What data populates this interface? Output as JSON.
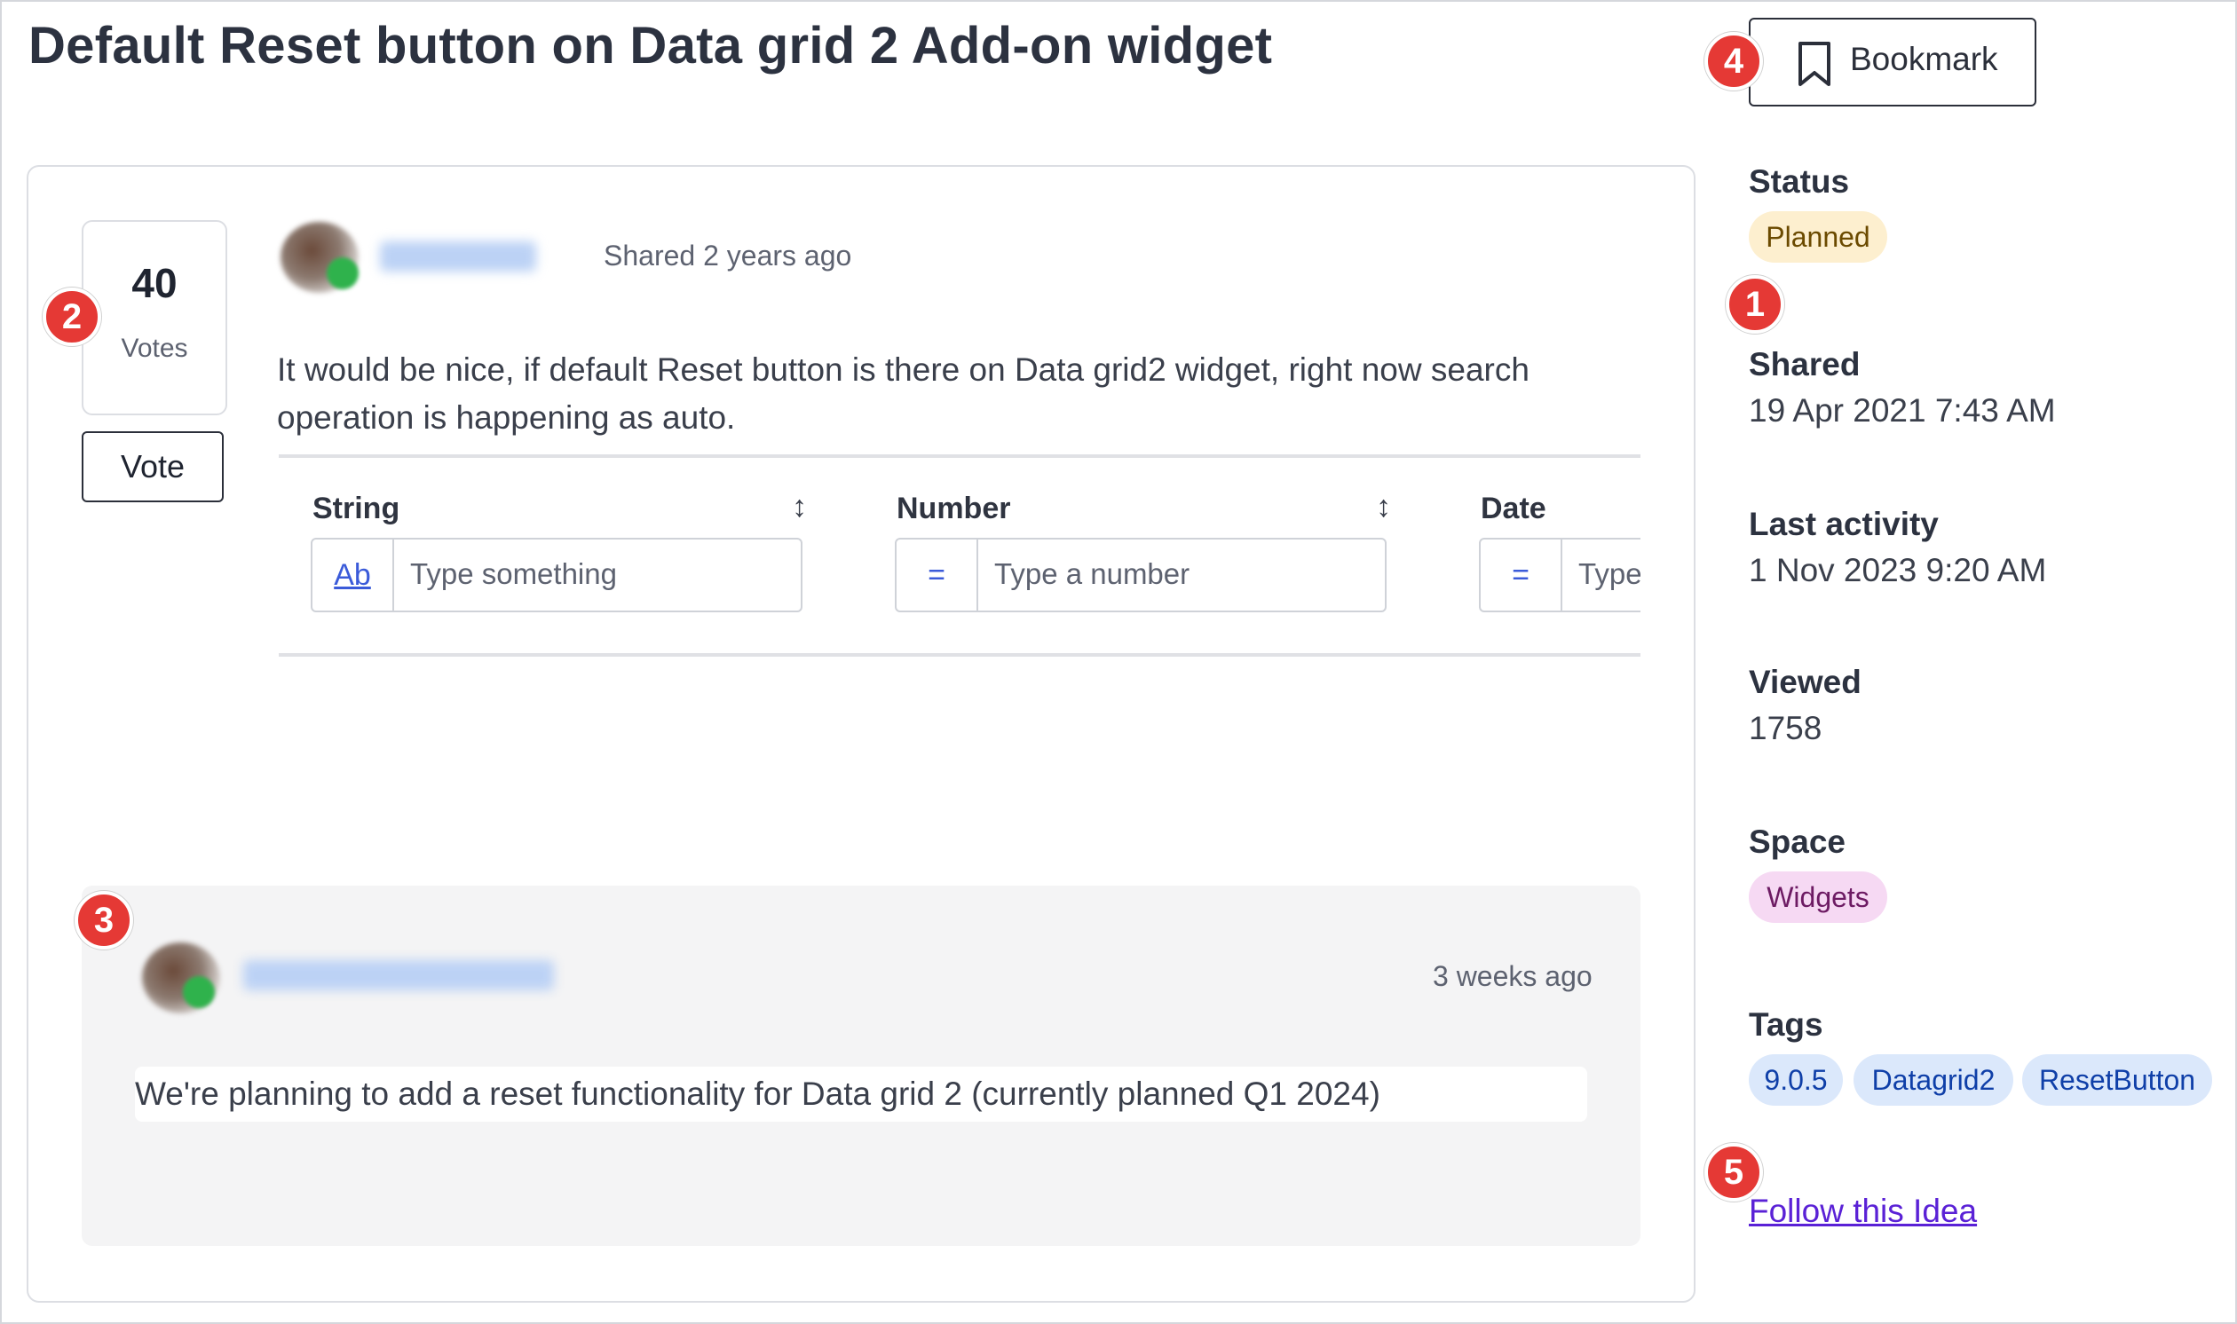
{
  "page": {
    "title": "Default Reset button on Data grid 2 Add-on widget"
  },
  "votes": {
    "count": "40",
    "label": "Votes",
    "button_label": "Vote"
  },
  "post": {
    "shared_text": "Shared 2 years ago",
    "body": "It would be nice, if default Reset button is there on Data grid2 widget, right now search operation is happening as auto.",
    "screenshot": {
      "columns": [
        {
          "label": "String",
          "prefix": "Ab",
          "placeholder": "Type something"
        },
        {
          "label": "Number",
          "prefix": "=",
          "placeholder": "Type a number"
        },
        {
          "label": "Date",
          "prefix": "=",
          "placeholder": "Type"
        }
      ],
      "sort_glyph": "↕"
    }
  },
  "reply": {
    "time": "3 weeks ago",
    "body": "We're planning to add a reset functionality for Data grid 2 (currently planned Q1 2024)"
  },
  "sidebar": {
    "bookmark_label": "Bookmark",
    "status": {
      "label": "Status",
      "value": "Planned",
      "color": "#fdefcf"
    },
    "shared": {
      "label": "Shared",
      "value": "19 Apr 2021 7:43 AM"
    },
    "last_activity": {
      "label": "Last activity",
      "value": "1 Nov 2023 9:20 AM"
    },
    "viewed": {
      "label": "Viewed",
      "value": "1758"
    },
    "space": {
      "label": "Space",
      "value": "Widgets",
      "color": "#f6d9f3"
    },
    "tags": {
      "label": "Tags",
      "items": [
        "9.0.5",
        "Datagrid2",
        "ResetButton"
      ],
      "color": "#dbe8fb"
    },
    "follow_link": "Follow this Idea"
  },
  "markers": [
    "1",
    "2",
    "3",
    "4",
    "5"
  ],
  "colors": {
    "marker": "#e53935",
    "link": "#5a21d6",
    "accent": "#3b5bd9"
  }
}
